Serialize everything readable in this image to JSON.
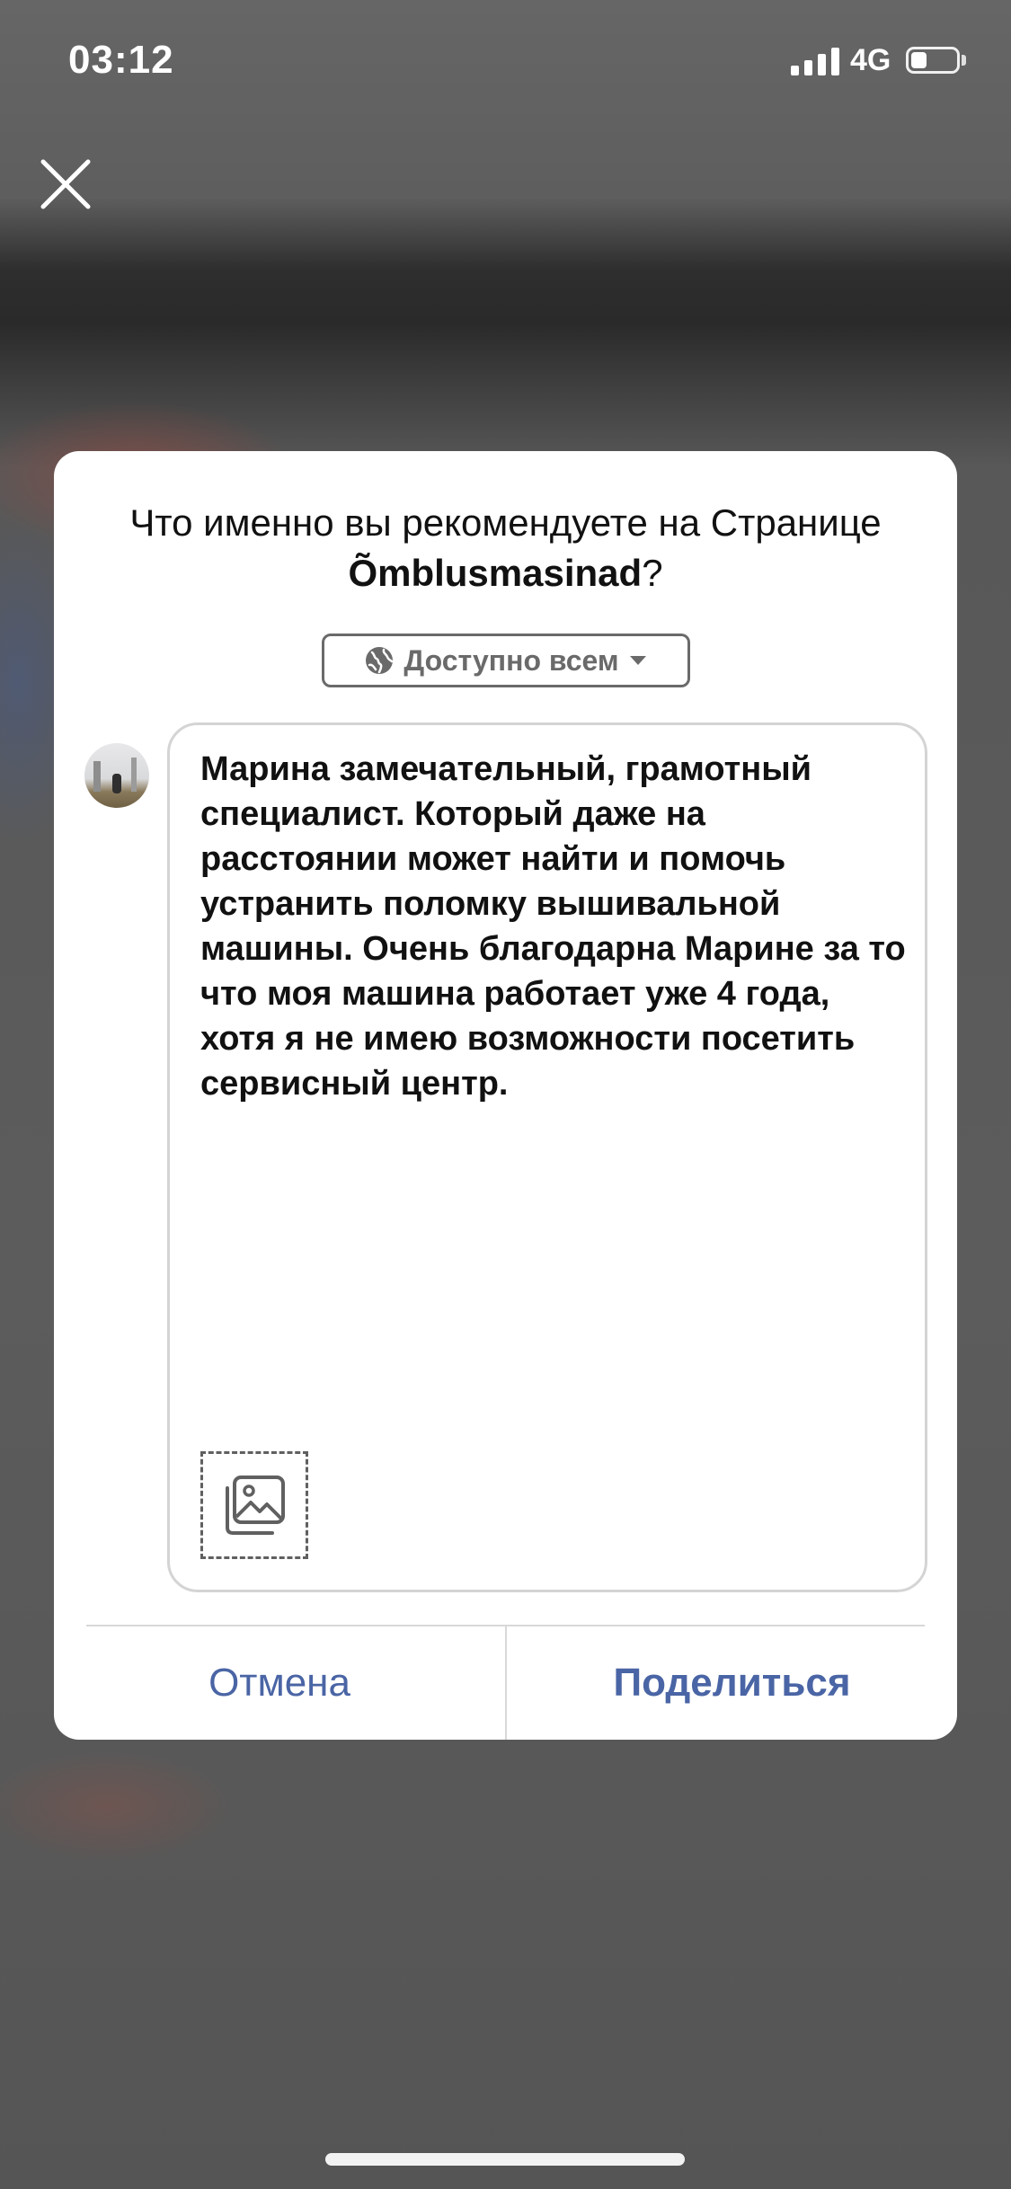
{
  "status_bar": {
    "time": "03:12",
    "network": "4G",
    "battery_level": 0.35
  },
  "dialog": {
    "title_prefix": "Что именно вы рекомендуете на Странице ",
    "title_page_name": "Õmblusmasinad",
    "title_suffix": "?",
    "privacy_label": "Доступно всем",
    "review_text": "Марина замечательный, грамотный специалист. Который даже на расстоянии может найти и помочь устранить поломку вышивальной машины. Очень благодарна Марине за то что моя машина работает уже 4 года, хотя я не имею возможности посетить сервисный центр.",
    "cancel_label": "Отмена",
    "share_label": "Поделиться"
  },
  "icons": {
    "close": "close-icon",
    "globe": "globe-icon",
    "dropdown": "caret-down-icon",
    "photo": "photo-gallery-icon"
  },
  "colors": {
    "accent": "#4a65a5",
    "text": "#111111",
    "muted": "#6a6a6a"
  }
}
